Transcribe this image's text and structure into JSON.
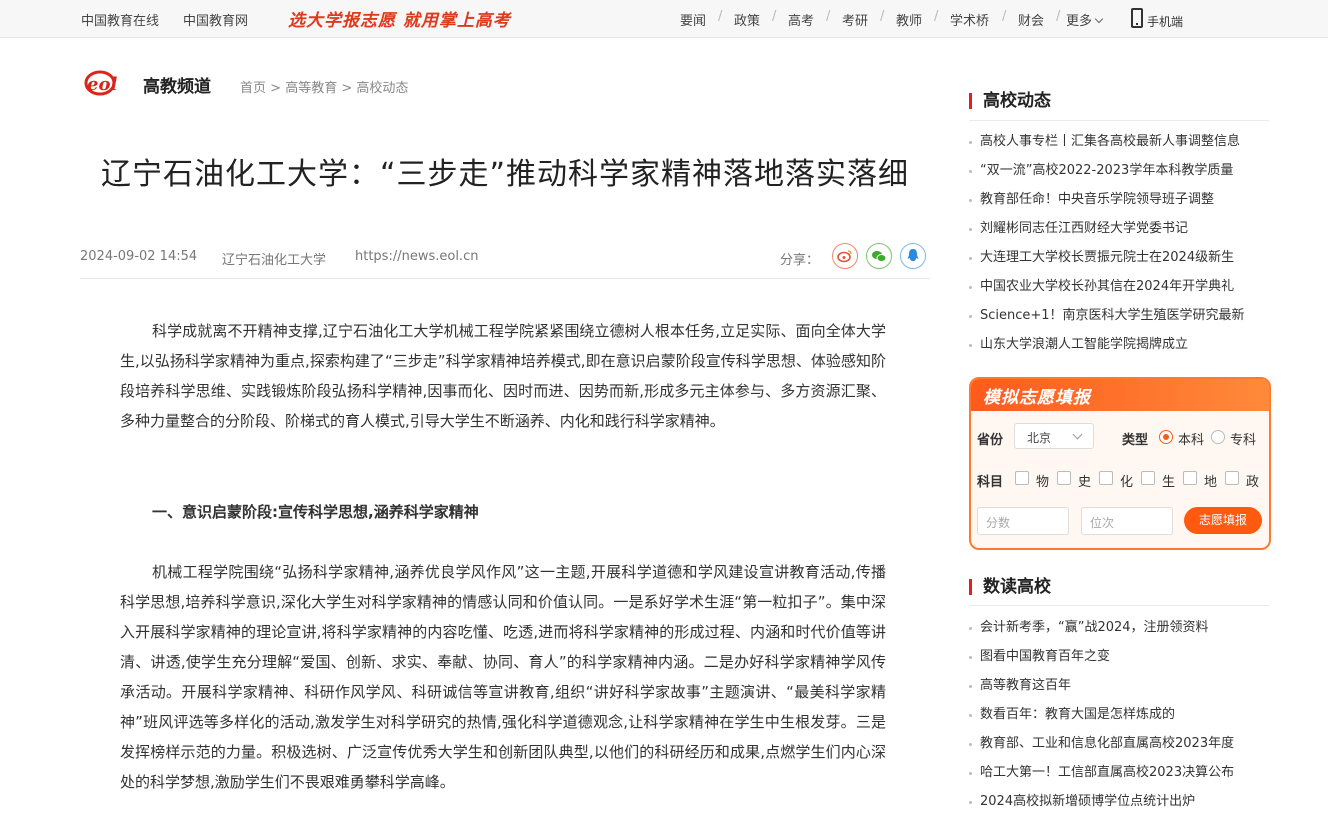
{
  "topbar": {
    "left_links": [
      "中国教育在线",
      "中国教育网"
    ],
    "slogan": "选大学报志愿 就用掌上高考",
    "nav": [
      "要闻",
      "政策",
      "高考",
      "考研",
      "教师",
      "学术桥",
      "财会"
    ],
    "more": "更多",
    "phone": "手机端"
  },
  "channel": {
    "logo_text": "eol",
    "name": "高教频道",
    "breadcrumb": [
      "首页",
      "高等教育",
      "高校动态"
    ]
  },
  "article": {
    "title": "辽宁石油化工大学：“三步走”推动科学家精神落地落实落细",
    "date": "2024-09-02 14:54",
    "source": "辽宁石油化工大学",
    "url": "https://news.eol.cn",
    "share_label": "分享：",
    "p1": "科学成就离不开精神支撑,辽宁石油化工大学机械工程学院紧紧围绕立德树人根本任务,立足实际、面向全体大学生,以弘扬科学家精神为重点,探索构建了“三步走”科学家精神培养模式,即在意识启蒙阶段宣传科学思想、体验感知阶段培养科学思维、实践锻炼阶段弘扬科学精神,因事而化、因时而进、因势而新,形成多元主体参与、多方资源汇聚、多种力量整合的分阶段、阶梯式的育人模式,引导大学生不断涵养、内化和践行科学家精神。",
    "h1": "一、意识启蒙阶段:宣传科学思想,涵养科学家精神",
    "p2": "机械工程学院围绕“弘扬科学家精神,涵养优良学风作风”这一主题,开展科学道德和学风建设宣讲教育活动,传播科学思想,培养科学意识,深化大学生对科学家精神的情感认同和价值认同。一是系好学术生涯“第一粒扣子”。集中深入开展科学家精神的理论宣讲,将科学家精神的内容吃懂、吃透,进而将科学家精神的形成过程、内涵和时代价值等讲清、讲透,使学生充分理解“爱国、创新、求实、奉献、协同、育人”的科学家精神内涵。二是办好科学家精神学风传承活动。开展科学家精神、科研作风学风、科研诚信等宣讲教育,组织“讲好科学家故事”主题演讲、“最美科学家精神”班风评选等多样化的活动,激发学生对科学研究的热情,强化科学道德观念,让科学家精神在学生中生根发芽。三是发挥榜样示范的力量。积极选树、广泛宣传优秀大学生和创新团队典型,以他们的科研经历和成果,点燃学生们内心深处的科学梦想,激励学生们不畏艰难勇攀科学高峰。"
  },
  "sidebar": {
    "news_title": "高校动态",
    "news": [
      "高校人事专栏丨汇集各高校最新人事调整信息",
      "“双一流”高校2022-2023学年本科教学质量",
      "教育部任命！中央音乐学院领导班子调整",
      "刘耀彬同志任江西财经大学党委书记",
      "大连理工大学校长贾振元院士在2024级新生",
      "中国农业大学校长孙其信在2024年开学典礼",
      "Science+1！南京医科大学生殖医学研究最新",
      "山东大学浪潮人工智能学院揭牌成立"
    ],
    "widget": {
      "title": "模拟志愿填报",
      "province_label": "省份",
      "province_value": "北京",
      "type_label": "类型",
      "type_options": [
        "本科",
        "专科"
      ],
      "subject_label": "科目",
      "subjects": [
        "物",
        "史",
        "化",
        "生",
        "地",
        "政"
      ],
      "score_placeholder": "分数",
      "rank_placeholder": "位次",
      "submit": "志愿填报"
    },
    "data_title": "数读高校",
    "data": [
      "会计新考季，“赢”战2024，注册领资料",
      "图看中国教育百年之变",
      "高等教育这百年",
      "数看百年：教育大国是怎样炼成的",
      "教育部、工业和信息化部直属高校2023年度",
      "哈工大第一！工信部直属高校2023决算公布",
      "2024高校拟新增硕博学位点统计出炉"
    ]
  }
}
